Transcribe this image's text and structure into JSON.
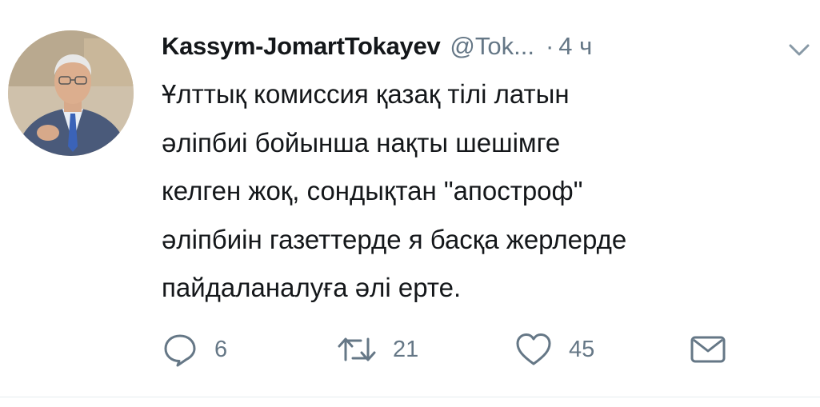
{
  "tweet": {
    "display_name": "Kassym-JomartTokayev",
    "handle": "@Tok...",
    "separator": "·",
    "time": "4 ч",
    "text_lines": [
      "Ұлттық комиссия қазақ тілі латын",
      "әліпбиі бойынша нақты шешімге",
      "келген жоқ, сондықтан \"апостроф\"",
      "әліпбиін газеттерде я басқа жерлерде",
      "пайдаланалуға әлі ерте."
    ]
  },
  "actions": {
    "reply_icon": "reply-icon",
    "reply_count": "6",
    "retweet_icon": "retweet-icon",
    "retweet_count": "21",
    "like_icon": "heart-icon",
    "like_count": "45",
    "dm_icon": "envelope-icon"
  },
  "colors": {
    "text_primary": "#14171a",
    "text_secondary": "#657786",
    "divider": "#e6ecf0"
  }
}
